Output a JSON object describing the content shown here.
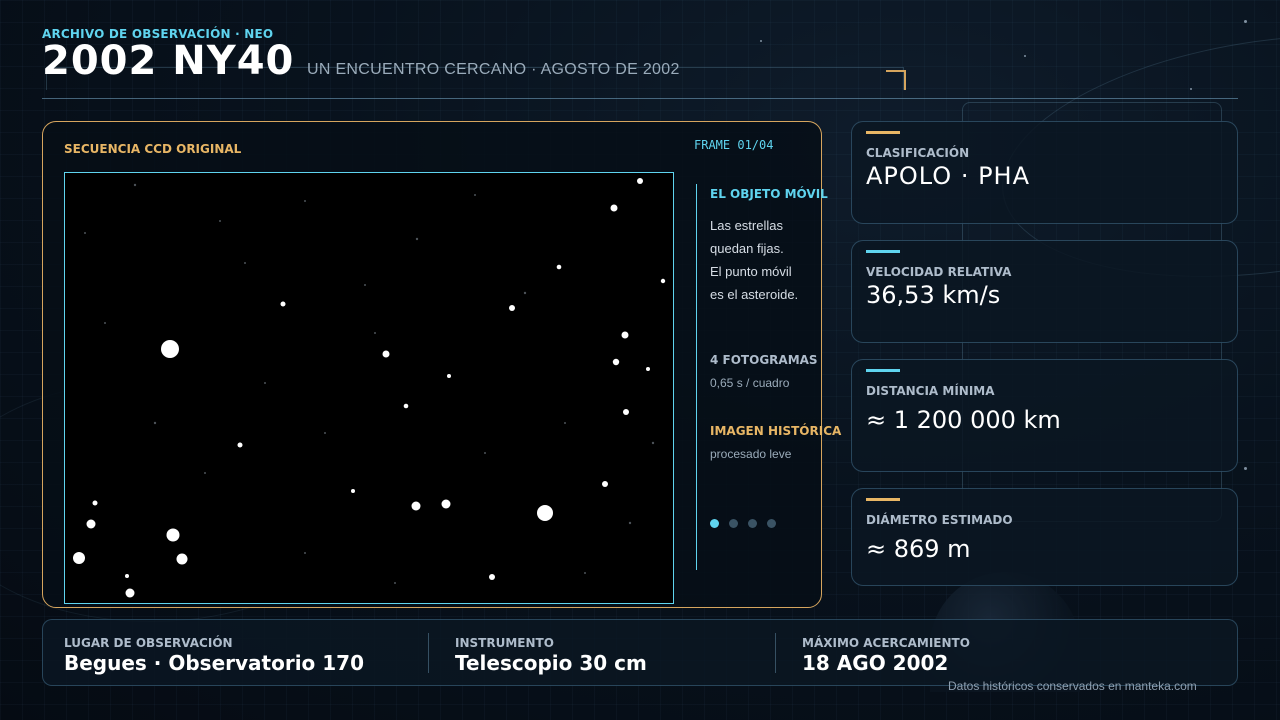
{
  "header": {
    "kicker": "ARCHIVO DE OBSERVACIÓN · NEO",
    "title": "2002 NY40",
    "subtitle": "UN ENCUENTRO CERCANO · AGOSTO DE 2002"
  },
  "viewer": {
    "label": "SECUENCIA CCD ORIGINAL",
    "frame_counter": "FRAME 01/04",
    "current_frame": 1,
    "total_frames": 4,
    "accent_color": "#d6a55e",
    "frame_color": "#5fd4ef"
  },
  "sidebar": {
    "moving_object": {
      "heading": "EL OBJETO MÓVIL",
      "lines": [
        "Las estrellas",
        "quedan fijas.",
        "El punto móvil",
        "es el asteroide."
      ]
    },
    "frames": {
      "heading": "4 FOTOGRAMAS",
      "detail": "0,65 s / cuadro"
    },
    "historic": {
      "heading": "IMAGEN HISTÓRICA",
      "detail": "procesado leve"
    }
  },
  "stats": [
    {
      "label": "CLASIFICACIÓN",
      "value": "APOLO · PHA",
      "accent": "#e8b665"
    },
    {
      "label": "VELOCIDAD RELATIVA",
      "value": "36,53 km/s",
      "accent": "#5fd4ef"
    },
    {
      "label": "DISTANCIA MÍNIMA",
      "value": "≈ 1 200 000 km",
      "accent": "#5fd4ef"
    },
    {
      "label": "DIÁMETRO ESTIMADO",
      "value": "≈ 869 m",
      "accent": "#e8b665"
    }
  ],
  "bottom": {
    "location": {
      "label": "LUGAR DE OBSERVACIÓN",
      "value": "Begues · Observatorio 170"
    },
    "instrument": {
      "label": "INSTRUMENTO",
      "value": "Telescopio 30 cm"
    },
    "closest": {
      "label": "MÁXIMO ACERCAMIENTO",
      "value": "18 AGO 2002"
    }
  },
  "footer": "Datos históricos conservados en manteka.com"
}
